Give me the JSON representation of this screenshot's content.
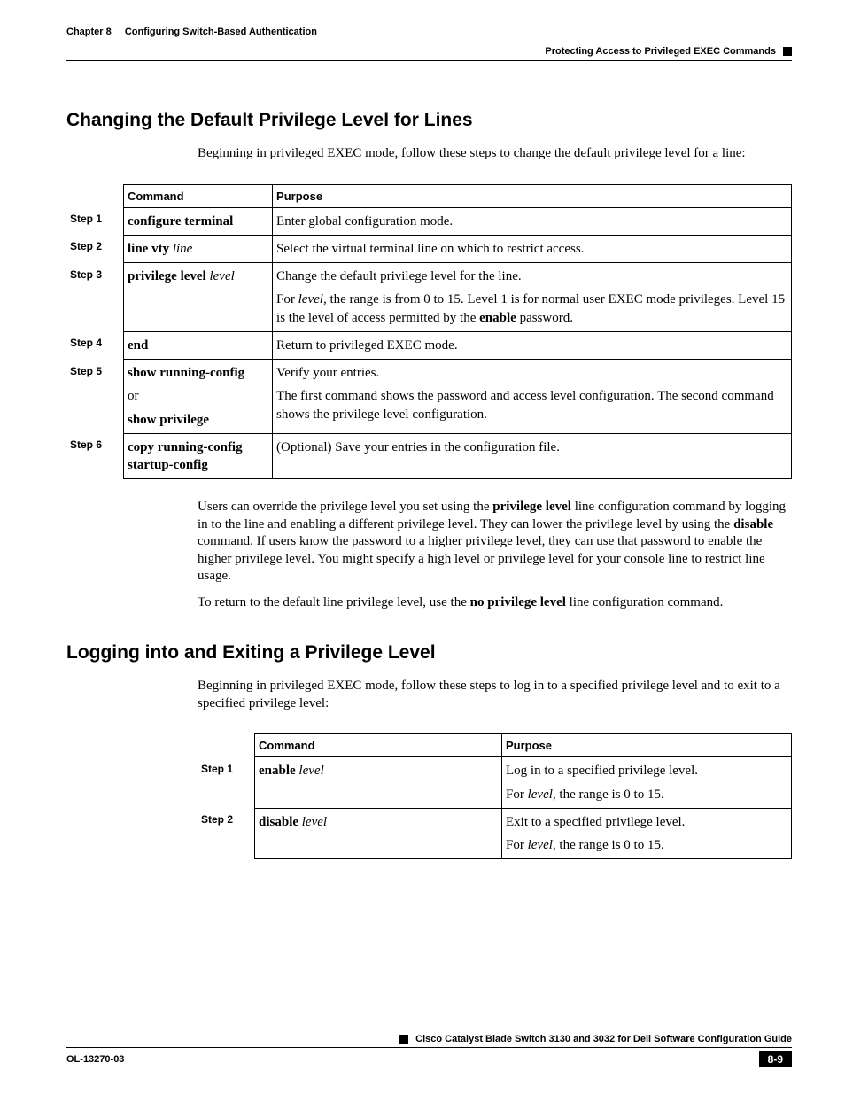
{
  "header": {
    "chapter_label": "Chapter 8",
    "chapter_title": "Configuring Switch-Based Authentication",
    "section_breadcrumb": "Protecting Access to Privileged EXEC Commands"
  },
  "section1": {
    "title": "Changing the Default Privilege Level for Lines",
    "intro": "Beginning in privileged EXEC mode, follow these steps to change the default privilege level for a line:",
    "th_command": "Command",
    "th_purpose": "Purpose",
    "steps": {
      "s1": {
        "label": "Step 1",
        "cmd": "configure terminal",
        "purpose": "Enter global configuration mode."
      },
      "s2": {
        "label": "Step 2",
        "cmd_a": "line vty",
        "cmd_b": "line",
        "purpose": "Select the virtual terminal line on which to restrict access."
      },
      "s3": {
        "label": "Step 3",
        "cmd_a": "privilege level",
        "cmd_b": "level",
        "p1": "Change the default privilege level for the line.",
        "p2a": "For ",
        "p2b": "level",
        "p2c": ", the range is from 0 to 15. Level 1 is for normal user EXEC mode privileges. Level 15 is the level of access permitted by the ",
        "p2d": "enable",
        "p2e": " password."
      },
      "s4": {
        "label": "Step 4",
        "cmd": "end",
        "purpose": "Return to privileged EXEC mode."
      },
      "s5": {
        "label": "Step 5",
        "cmd_a": "show running-config",
        "cmd_or": "or",
        "cmd_b": "show privilege",
        "p1": "Verify your entries.",
        "p2": "The first command shows the password and access level configuration. The second command shows the privilege level configuration."
      },
      "s6": {
        "label": "Step 6",
        "cmd": "copy running-config startup-config",
        "purpose": "(Optional) Save your entries in the configuration file."
      }
    },
    "para1a": "Users can override the privilege level you set using the ",
    "para1b": "privilege level",
    "para1c": " line configuration command by logging in to the line and enabling a different privilege level. They can lower the privilege level by using the ",
    "para1d": "disable",
    "para1e": " command. If users know the password to a higher privilege level, they can use that password to enable the higher privilege level. You might specify a high level or privilege level for your console line to restrict line usage.",
    "para2a": "To return to the default line privilege level, use the ",
    "para2b": "no privilege level",
    "para2c": " line configuration command."
  },
  "section2": {
    "title": "Logging into and Exiting a Privilege Level",
    "intro": "Beginning in privileged EXEC mode, follow these steps to log in to a specified privilege level and to exit to a specified privilege level:",
    "th_command": "Command",
    "th_purpose": "Purpose",
    "steps": {
      "s1": {
        "label": "Step 1",
        "cmd_a": "enable",
        "cmd_b": "level",
        "p1": "Log in to a specified privilege level.",
        "p2a": "For ",
        "p2b": "level",
        "p2c": ", the range is 0 to 15."
      },
      "s2": {
        "label": "Step 2",
        "cmd_a": "disable",
        "cmd_b": "level",
        "p1": "Exit to a specified privilege level.",
        "p2a": "For ",
        "p2b": "level",
        "p2c": ", the range is 0 to 15."
      }
    }
  },
  "footer": {
    "book_title": "Cisco Catalyst Blade Switch 3130 and 3032 for Dell Software Configuration Guide",
    "doc_id": "OL-13270-03",
    "page_num": "8-9"
  }
}
